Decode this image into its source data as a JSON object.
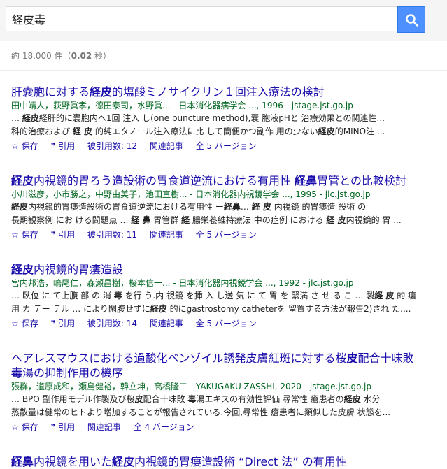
{
  "search": {
    "query": "経皮毒"
  },
  "stats": {
    "prefix": "約 18,000 件（",
    "time": "0.02",
    "suffix": " 秒）"
  },
  "actions_labels": {
    "save": "保存",
    "cite": "引用"
  },
  "results": [
    {
      "title_parts": [
        "肝嚢胞に対する",
        "経皮",
        "的塩酸ミノサイクリン１回注入療法の検討"
      ],
      "authors": "田中靖人，荻野眞孝，德田泰司，水野眞... - 日本消化器病学会 ..., 1996 - jstage.jst.go.jp",
      "snippet1": [
        "… ",
        "経皮",
        "経肝的に嚢胞内へ1回 注入 し(one puncture method),嚢 胞液pHと 治療効果との関連性..."
      ],
      "snippet2": [
        "科的治療および ",
        "経 皮",
        " 的純エタノール注入療法に比 して簡便かつ副作 用の少ない",
        "経皮",
        "的MINO注 ..."
      ],
      "cited": "被引用数: 12",
      "related": "関連記事",
      "versions": "全 5 バージョン"
    },
    {
      "title_parts": [
        "経皮",
        "内視鏡的胃ろう造設術の胃食道逆流における有用性 ",
        "経鼻",
        "胃管との比較検討"
      ],
      "authors": "小川滋彦，小市勝之，中野由美子，池田直樹... - 日本消化器内視鏡学会 ..., 1995 - jlc.jst.go.jp",
      "snippet1": [
        "",
        "経皮",
        "内視鏡的胃瘻造設術の胃食道逆流における有用性 ー",
        "経鼻",
        "… ",
        "経 皮",
        " 内視鏡 的胃瘻造 設術 の"
      ],
      "snippet2": [
        "長期観察例 にお ける問題点 … ",
        "経 鼻",
        " 胃管群 ",
        "経",
        " 腸栄養維持療法 中の症例 における ",
        "経 皮",
        "内視鏡的 胃 ..."
      ],
      "cited": "被引用数: 11",
      "related": "関連記事",
      "versions": "全 5 バージョン"
    },
    {
      "title_parts": [
        "経皮",
        "内視鏡的胃瘻造設",
        "",
        ""
      ],
      "authors": "宮内邦浩，嶋尾仁，森瀬昌樹，桜本信一... - 日本消化器内視鏡学会 ..., 1992 - jlc.jst.go.jp",
      "snippet1": [
        "… 臥位 に て上腹 部 の 消 ",
        "毒",
        " を行 う.内 視鏡 を挿 入 し送 気 に て 胃 を 緊満 さ せ る こ … 製",
        "経 皮",
        " 的 瘻"
      ],
      "snippet2": [
        "用 カ テー テル … により閑腹せずに",
        "経皮",
        " 的にgastrostomy catheterを 留置する方法が報告2)され た....",
        "",
        ""
      ],
      "cited": "被引用数: 14",
      "related": "関連記事",
      "versions": "全 5 バージョン"
    },
    {
      "title_line1": [
        "ヘアレスマウスにおける過酸化ベンゾイル誘発皮膚紅斑に対する桜",
        "皮",
        "配合十味敗"
      ],
      "title_line2": [
        "",
        "毒",
        "湯の抑制作用の機序"
      ],
      "authors": "張群，道原成和，瀬島健裕，韓立坤，高橋隆二 - YAKUGAKU ZASSHI, 2020 - jstage.jst.go.jp",
      "snippet1": [
        "… BPO 副作用モデル作製及び桜",
        "皮",
        "配合十味敗 ",
        "毒",
        "湯エキスの有効性評価 尋常性 瘡患者の",
        "経皮",
        " 水分"
      ],
      "snippet2": [
        "蒸散量は健常のヒトより増加することが報告されている.今回,尋常性 瘡患者に類似した皮膚 状態を...",
        "",
        "",
        "",
        "",
        ""
      ],
      "related": "関連記事",
      "versions": "全 4 バージョン"
    },
    {
      "title_parts": [
        "経鼻",
        "内視鏡を用いた",
        "経皮",
        "内視鏡的胃瘻造設術 “Direct 法” の有用性"
      ]
    }
  ]
}
